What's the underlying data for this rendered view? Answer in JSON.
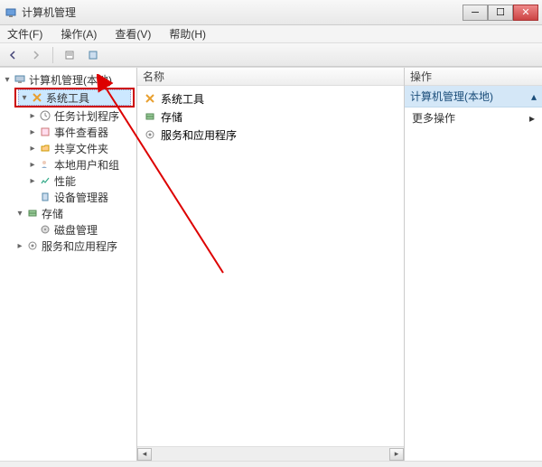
{
  "window": {
    "title": "计算机管理"
  },
  "menu": {
    "file": "文件(F)",
    "action": "操作(A)",
    "view": "查看(V)",
    "help": "帮助(H)"
  },
  "tree": {
    "root": "计算机管理(本地)",
    "systemTools": "系统工具",
    "taskScheduler": "任务计划程序",
    "eventViewer": "事件查看器",
    "sharedFolders": "共享文件夹",
    "localUsers": "本地用户和组",
    "performance": "性能",
    "deviceManager": "设备管理器",
    "storage": "存储",
    "diskManagement": "磁盘管理",
    "services": "服务和应用程序"
  },
  "list": {
    "header": "名称",
    "items": {
      "systemTools": "系统工具",
      "storage": "存储",
      "services": "服务和应用程序"
    }
  },
  "actions": {
    "header": "操作",
    "section": "计算机管理(本地)",
    "more": "更多操作"
  }
}
